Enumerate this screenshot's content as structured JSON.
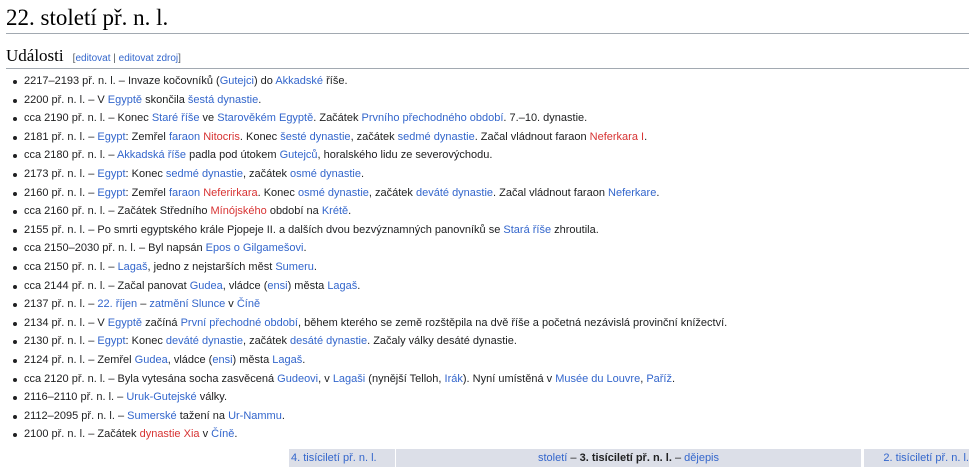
{
  "page": {
    "title": "22. století př. n. l."
  },
  "section": {
    "title": "Události",
    "bracket_open": "[",
    "edit": "editovat",
    "sep": " | ",
    "edit_source": "editovat zdroj",
    "bracket_close": "]"
  },
  "events": [
    [
      {
        "t": "2217–2193 př. n. l. – Invaze kočovníků ("
      },
      {
        "t": "Gutejci",
        "c": "blue"
      },
      {
        "t": ") do "
      },
      {
        "t": "Akkadské",
        "c": "blue"
      },
      {
        "t": " říše."
      }
    ],
    [
      {
        "t": "2200 př. n. l. – V "
      },
      {
        "t": "Egyptě",
        "c": "blue"
      },
      {
        "t": " skončila "
      },
      {
        "t": "šestá dynastie",
        "c": "blue"
      },
      {
        "t": "."
      }
    ],
    [
      {
        "t": "cca 2190 př. n. l. – Konec "
      },
      {
        "t": "Staré říše",
        "c": "blue"
      },
      {
        "t": " ve "
      },
      {
        "t": "Starověkém Egyptě",
        "c": "blue"
      },
      {
        "t": ". Začátek "
      },
      {
        "t": "Prvního přechodného období",
        "c": "blue"
      },
      {
        "t": ". 7.–10. dynastie."
      }
    ],
    [
      {
        "t": "2181 př. n. l. – "
      },
      {
        "t": "Egypt",
        "c": "blue"
      },
      {
        "t": ": Zemřel "
      },
      {
        "t": "faraon",
        "c": "blue"
      },
      {
        "t": " "
      },
      {
        "t": "Nitocris",
        "c": "red"
      },
      {
        "t": ". Konec "
      },
      {
        "t": "šesté dynastie",
        "c": "blue"
      },
      {
        "t": ", začátek "
      },
      {
        "t": "sedmé dynastie",
        "c": "blue"
      },
      {
        "t": ". Začal vládnout faraon "
      },
      {
        "t": "Neferkara I",
        "c": "red"
      },
      {
        "t": "."
      }
    ],
    [
      {
        "t": "cca 2180 př. n. l. – "
      },
      {
        "t": "Akkadská říše",
        "c": "blue"
      },
      {
        "t": " padla pod útokem "
      },
      {
        "t": "Gutejců",
        "c": "blue"
      },
      {
        "t": ", horalského lidu ze severovýchodu."
      }
    ],
    [
      {
        "t": "2173 př. n. l. – "
      },
      {
        "t": "Egypt",
        "c": "blue"
      },
      {
        "t": ": Konec "
      },
      {
        "t": "sedmé dynastie",
        "c": "blue"
      },
      {
        "t": ", začátek "
      },
      {
        "t": "osmé dynastie",
        "c": "blue"
      },
      {
        "t": "."
      }
    ],
    [
      {
        "t": "2160 př. n. l. – "
      },
      {
        "t": "Egypt",
        "c": "blue"
      },
      {
        "t": ": Zemřel "
      },
      {
        "t": "faraon",
        "c": "blue"
      },
      {
        "t": " "
      },
      {
        "t": "Neferirkara",
        "c": "red"
      },
      {
        "t": ". Konec "
      },
      {
        "t": "osmé dynastie",
        "c": "blue"
      },
      {
        "t": ", začátek "
      },
      {
        "t": "deváté dynastie",
        "c": "blue"
      },
      {
        "t": ". Začal vládnout faraon "
      },
      {
        "t": "Neferkare",
        "c": "blue"
      },
      {
        "t": "."
      }
    ],
    [
      {
        "t": "cca 2160 př. n. l. – Začátek Středního "
      },
      {
        "t": "Mínójského",
        "c": "red"
      },
      {
        "t": " období na "
      },
      {
        "t": "Krétě",
        "c": "blue"
      },
      {
        "t": "."
      }
    ],
    [
      {
        "t": "2155 př. n. l. – Po smrti egyptského krále Pjopeje II. a dalších dvou bezvýznamných panovníků se "
      },
      {
        "t": "Stará říše",
        "c": "blue"
      },
      {
        "t": " zhroutila."
      }
    ],
    [
      {
        "t": "cca 2150–2030 př. n. l. – Byl napsán "
      },
      {
        "t": "Epos o Gilgamešovi",
        "c": "blue"
      },
      {
        "t": "."
      }
    ],
    [
      {
        "t": "cca 2150 př. n. l. – "
      },
      {
        "t": "Lagaš",
        "c": "blue"
      },
      {
        "t": ", jedno z nejstarších měst "
      },
      {
        "t": "Sumeru",
        "c": "blue"
      },
      {
        "t": "."
      }
    ],
    [
      {
        "t": "cca 2144 př. n. l. – Začal panovat "
      },
      {
        "t": "Gudea",
        "c": "blue"
      },
      {
        "t": ", vládce ("
      },
      {
        "t": "ensi",
        "c": "blue"
      },
      {
        "t": ") města "
      },
      {
        "t": "Lagaš",
        "c": "blue"
      },
      {
        "t": "."
      }
    ],
    [
      {
        "t": "2137 př. n. l. – "
      },
      {
        "t": "22. říjen",
        "c": "blue"
      },
      {
        "t": " – "
      },
      {
        "t": "zatmění Slunce",
        "c": "blue"
      },
      {
        "t": " v "
      },
      {
        "t": "Číně",
        "c": "blue"
      }
    ],
    [
      {
        "t": "2134 př. n. l. – V "
      },
      {
        "t": "Egyptě",
        "c": "blue"
      },
      {
        "t": " začíná "
      },
      {
        "t": "První přechodné období",
        "c": "blue"
      },
      {
        "t": ", během kterého se země rozštěpila na dvě říše a početná nezávislá provinční knížectví."
      }
    ],
    [
      {
        "t": "2130 př. n. l. – "
      },
      {
        "t": "Egypt",
        "c": "blue"
      },
      {
        "t": ": Konec "
      },
      {
        "t": "deváté dynastie",
        "c": "blue"
      },
      {
        "t": ", začátek "
      },
      {
        "t": "desáté dynastie",
        "c": "blue"
      },
      {
        "t": ". Začaly války desáté dynastie."
      }
    ],
    [
      {
        "t": "2124 př. n. l. – Zemřel "
      },
      {
        "t": "Gudea",
        "c": "blue"
      },
      {
        "t": ", vládce ("
      },
      {
        "t": "ensi",
        "c": "blue"
      },
      {
        "t": ") města "
      },
      {
        "t": "Lagaš",
        "c": "blue"
      },
      {
        "t": "."
      }
    ],
    [
      {
        "t": "cca 2120 př. n. l. – Byla vytesána socha zasvěcená "
      },
      {
        "t": "Gudeovi",
        "c": "blue"
      },
      {
        "t": ", v "
      },
      {
        "t": "Lagaši",
        "c": "blue"
      },
      {
        "t": " (nynější Telloh, "
      },
      {
        "t": "Irák",
        "c": "blue"
      },
      {
        "t": "). Nyní umístěná v "
      },
      {
        "t": "Musée du Louvre",
        "c": "blue"
      },
      {
        "t": ", "
      },
      {
        "t": "Paříž",
        "c": "blue"
      },
      {
        "t": "."
      }
    ],
    [
      {
        "t": "2116–2110 př. n. l. – "
      },
      {
        "t": "Uruk-Gutejské",
        "c": "blue"
      },
      {
        "t": " války."
      }
    ],
    [
      {
        "t": "2112–2095 př. n. l. – "
      },
      {
        "t": "Sumerské",
        "c": "blue"
      },
      {
        "t": " tažení na "
      },
      {
        "t": "Ur-Nammu",
        "c": "blue"
      },
      {
        "t": "."
      }
    ],
    [
      {
        "t": "2100 př. n. l. – Začátek "
      },
      {
        "t": "dynastie Xia",
        "c": "red"
      },
      {
        "t": " v "
      },
      {
        "t": "Číně",
        "c": "blue"
      },
      {
        "t": "."
      }
    ]
  ],
  "navbox": {
    "left": "4. tisíciletí př. n. l.",
    "center_link": "století",
    "center_sep1": " – ",
    "center_current": "3. tisíciletí př. n. l.",
    "center_sep2": " – ",
    "center_link2": "dějepis",
    "right": "2. tisíciletí př. n. l."
  },
  "colors": {
    "link": "#3366cc",
    "redlink": "#d73333",
    "text": "#202122",
    "navbg": "#dcdfe8"
  }
}
